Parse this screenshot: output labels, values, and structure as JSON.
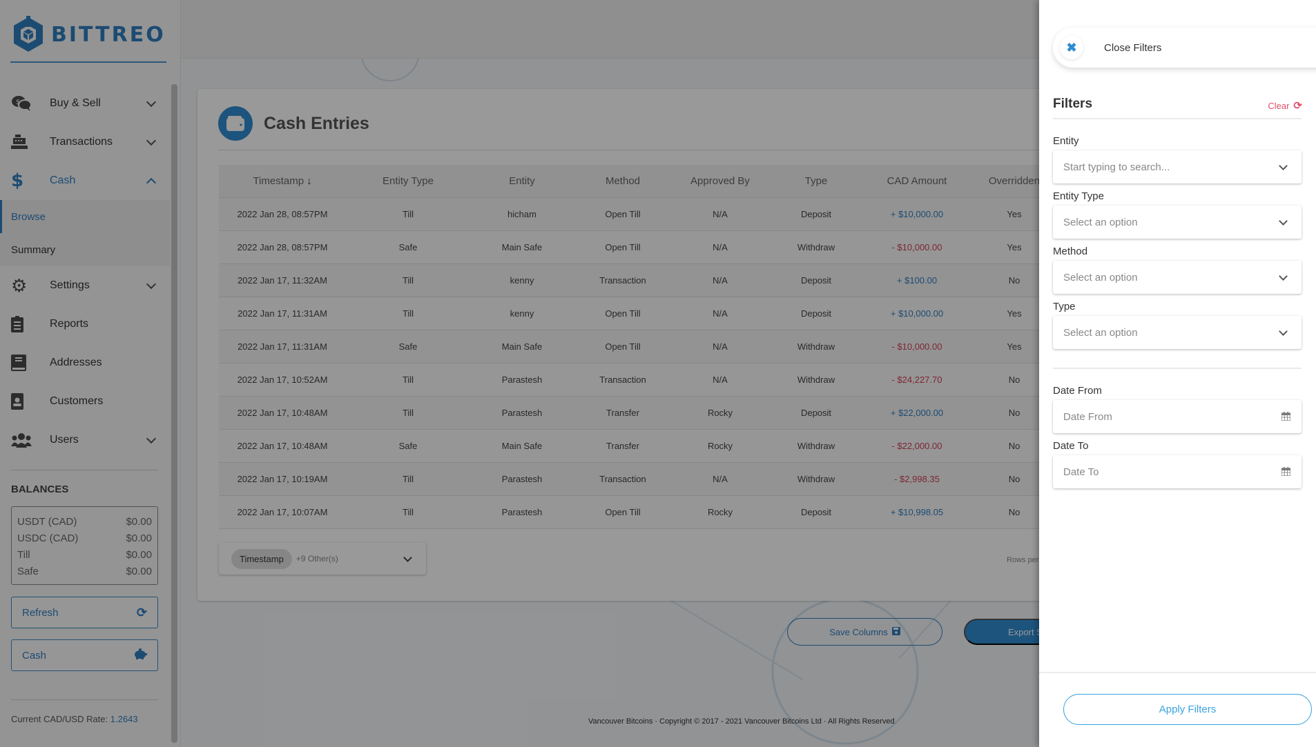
{
  "brand": {
    "name": "BITTREO",
    "color": "#2f7dbf"
  },
  "sidebar": {
    "items": [
      {
        "label": "Buy & Sell",
        "icon": "comments-dollar-icon",
        "expandable": true
      },
      {
        "label": "Transactions",
        "icon": "cash-register-icon",
        "expandable": true
      },
      {
        "label": "Cash",
        "icon": "dollar-icon",
        "expandable": true,
        "expanded": true,
        "active": true
      },
      {
        "label": "Settings",
        "icon": "gear-icon",
        "expandable": true
      },
      {
        "label": "Reports",
        "icon": "clipboard-list-icon",
        "expandable": false
      },
      {
        "label": "Addresses",
        "icon": "book-icon",
        "expandable": false
      },
      {
        "label": "Customers",
        "icon": "id-badge-icon",
        "expandable": false
      },
      {
        "label": "Users",
        "icon": "users-icon",
        "expandable": true
      }
    ],
    "cash_subitems": [
      {
        "label": "Browse",
        "active": true
      },
      {
        "label": "Summary",
        "active": false
      }
    ],
    "balances": {
      "title": "BALANCES",
      "rows": [
        {
          "label": "USDT (CAD)",
          "value": "$0.00"
        },
        {
          "label": "USDC (CAD)",
          "value": "$0.00"
        },
        {
          "label": "Till",
          "value": "$0.00"
        },
        {
          "label": "Safe",
          "value": "$0.00"
        }
      ]
    },
    "refresh_label": "Refresh",
    "cash_button_label": "Cash",
    "rate_label": "Current CAD/USD Rate:",
    "rate_value": "1.2643"
  },
  "main": {
    "card_title": "Cash Entries",
    "columns": [
      "Timestamp",
      "Entity Type",
      "Entity",
      "Method",
      "Approved By",
      "Type",
      "CAD Amount",
      "Overridden"
    ],
    "sort_column": "Timestamp",
    "sort_direction": "descending",
    "sort_arrow": "↓",
    "rows": [
      {
        "timestamp": "2022 Jan 28, 08:57PM",
        "entity_type": "Till",
        "entity": "hicham",
        "method": "Open Till",
        "approved_by": "N/A",
        "type": "Deposit",
        "amount": "+ $10,000.00",
        "sign": "pos",
        "overridden": "Yes"
      },
      {
        "timestamp": "2022 Jan 28, 08:57PM",
        "entity_type": "Safe",
        "entity": "Main Safe",
        "method": "Open Till",
        "approved_by": "N/A",
        "type": "Withdraw",
        "amount": "- $10,000.00",
        "sign": "neg",
        "overridden": "Yes"
      },
      {
        "timestamp": "2022 Jan 17, 11:32AM",
        "entity_type": "Till",
        "entity": "kenny",
        "method": "Transaction",
        "approved_by": "N/A",
        "type": "Deposit",
        "amount": "+ $100.00",
        "sign": "pos",
        "overridden": "No"
      },
      {
        "timestamp": "2022 Jan 17, 11:31AM",
        "entity_type": "Till",
        "entity": "kenny",
        "method": "Open Till",
        "approved_by": "N/A",
        "type": "Deposit",
        "amount": "+ $10,000.00",
        "sign": "pos",
        "overridden": "Yes"
      },
      {
        "timestamp": "2022 Jan 17, 11:31AM",
        "entity_type": "Safe",
        "entity": "Main Safe",
        "method": "Open Till",
        "approved_by": "N/A",
        "type": "Withdraw",
        "amount": "- $10,000.00",
        "sign": "neg",
        "overridden": "Yes"
      },
      {
        "timestamp": "2022 Jan 17, 10:52AM",
        "entity_type": "Till",
        "entity": "Parastesh",
        "method": "Transaction",
        "approved_by": "N/A",
        "type": "Withdraw",
        "amount": "- $24,227.70",
        "sign": "neg",
        "overridden": "No"
      },
      {
        "timestamp": "2022 Jan 17, 10:48AM",
        "entity_type": "Till",
        "entity": "Parastesh",
        "method": "Transfer",
        "approved_by": "Rocky",
        "type": "Deposit",
        "amount": "+ $22,000.00",
        "sign": "pos",
        "overridden": "No"
      },
      {
        "timestamp": "2022 Jan 17, 10:48AM",
        "entity_type": "Safe",
        "entity": "Main Safe",
        "method": "Transfer",
        "approved_by": "Rocky",
        "type": "Withdraw",
        "amount": "- $22,000.00",
        "sign": "neg",
        "overridden": "No"
      },
      {
        "timestamp": "2022 Jan 17, 10:19AM",
        "entity_type": "Till",
        "entity": "Parastesh",
        "method": "Transaction",
        "approved_by": "N/A",
        "type": "Withdraw",
        "amount": "- $2,998.35",
        "sign": "neg",
        "overridden": "No"
      },
      {
        "timestamp": "2022 Jan 17, 10:07AM",
        "entity_type": "Till",
        "entity": "Parastesh",
        "method": "Open Till",
        "approved_by": "Rocky",
        "type": "Deposit",
        "amount": "+ $10,998.05",
        "sign": "pos",
        "overridden": "No"
      }
    ],
    "column_selector": {
      "chip": "Timestamp",
      "others": "+9 Other(s)"
    },
    "rows_per_page_label": "Rows per",
    "save_columns_label": "Save Columns",
    "export_label": "Export S",
    "footer": "Vancouver Bitcoins · Copyright © 2017 - 2021 Vancouver Bitcoins Ltd · All Rights Reserved",
    "colors": {
      "positive": "#2f7dbf",
      "negative": "#d0405a"
    }
  },
  "filters": {
    "close_label": "Close Filters",
    "title": "Filters",
    "clear_label": "Clear",
    "fields": [
      {
        "label": "Entity",
        "placeholder": "Start typing to search...",
        "kind": "search-select"
      },
      {
        "label": "Entity Type",
        "placeholder": "Select an option",
        "kind": "select"
      },
      {
        "label": "Method",
        "placeholder": "Select an option",
        "kind": "select"
      },
      {
        "label": "Type",
        "placeholder": "Select an option",
        "kind": "select"
      }
    ],
    "date_fields": [
      {
        "label": "Date From",
        "placeholder": "Date From"
      },
      {
        "label": "Date To",
        "placeholder": "Date To"
      }
    ],
    "apply_label": "Apply Filters",
    "accent": "#3aa3e0",
    "clear_color": "#e0506a"
  }
}
